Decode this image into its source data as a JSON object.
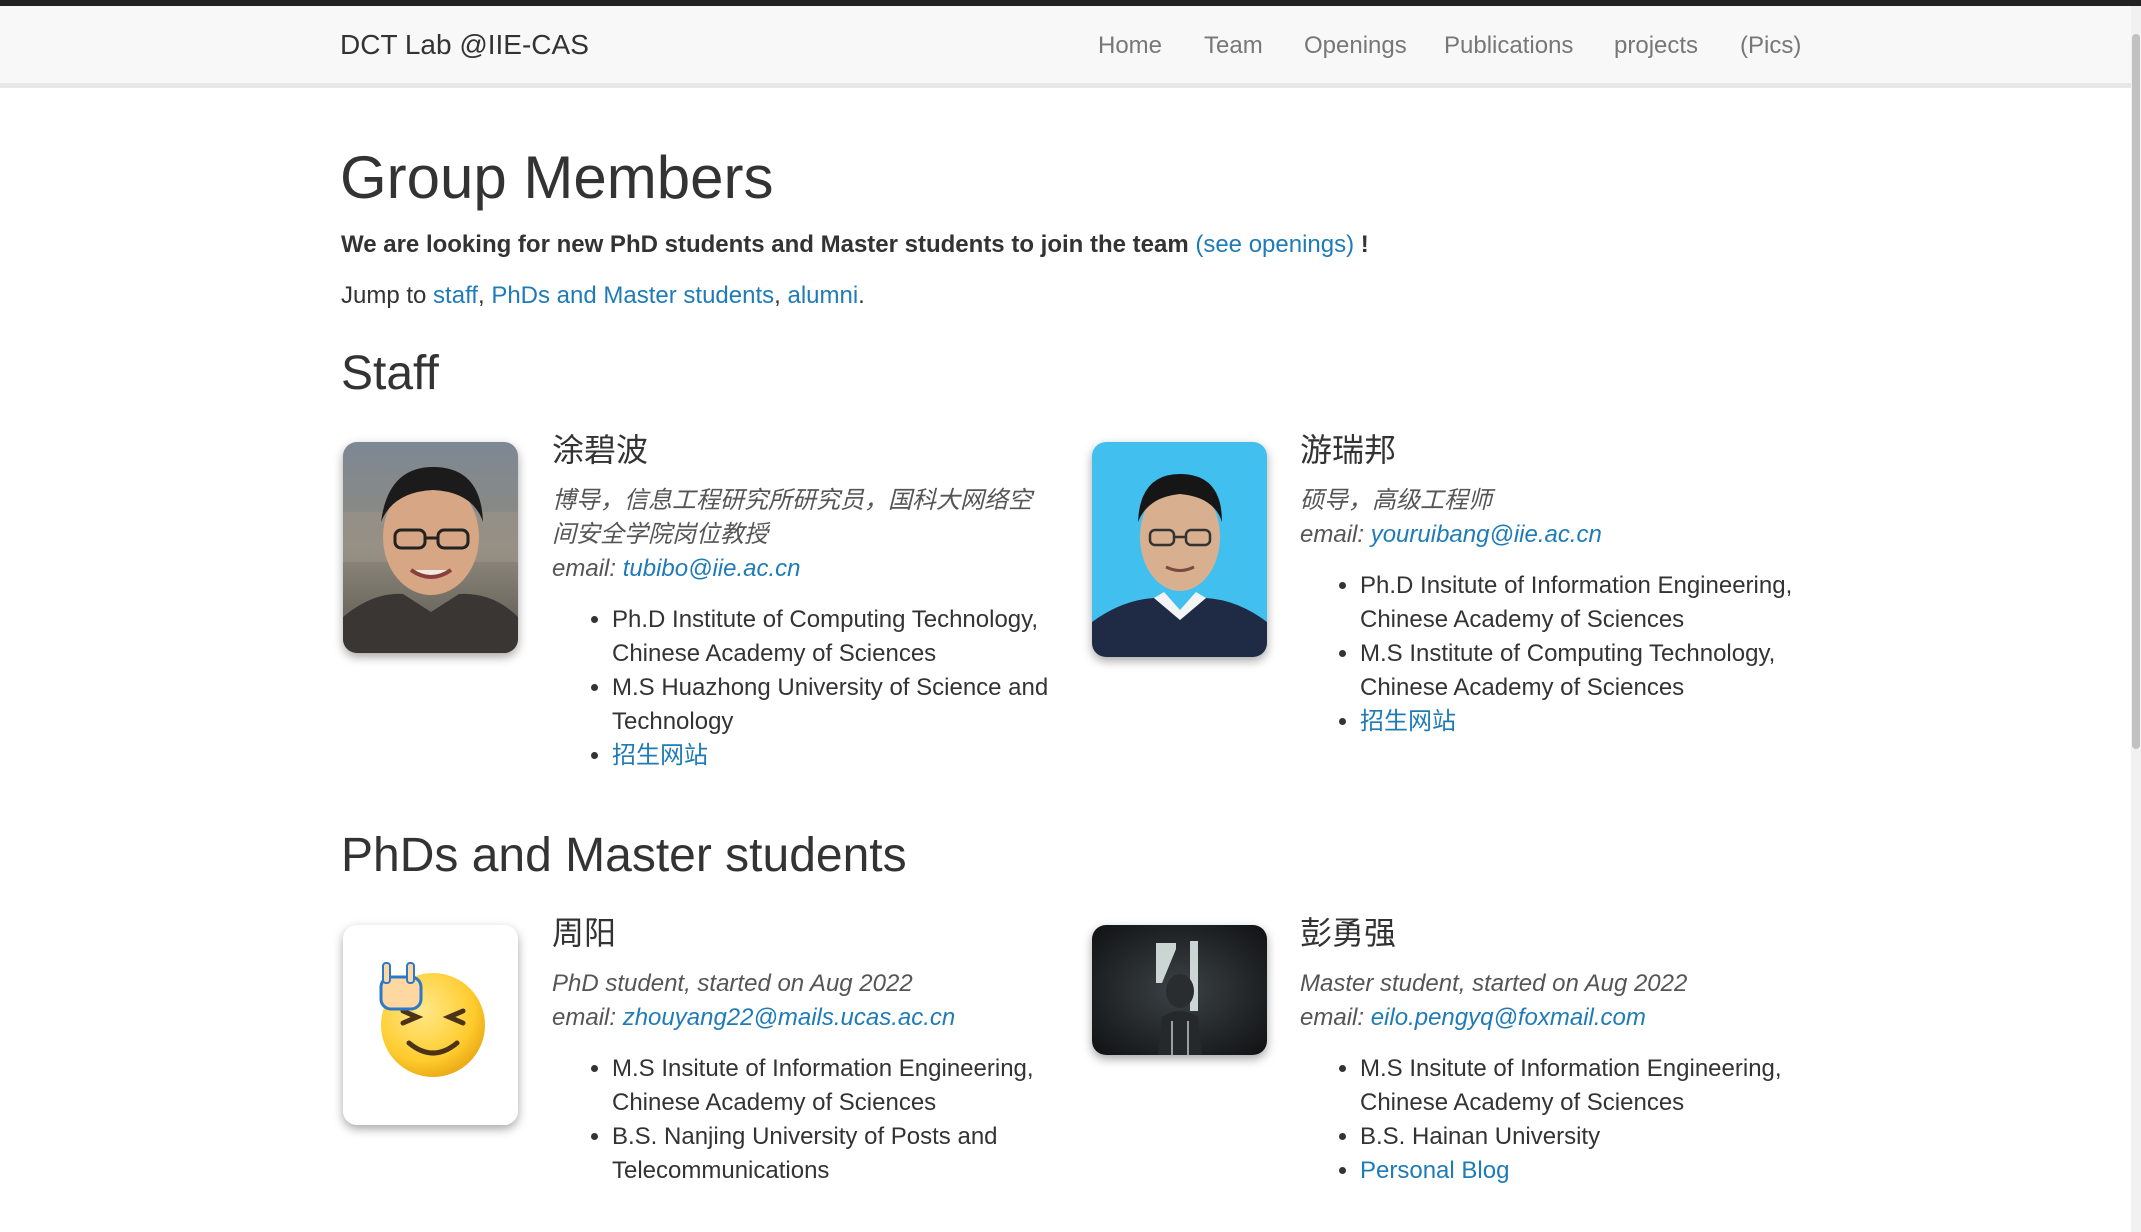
{
  "nav": {
    "brand": "DCT Lab @IIE-CAS",
    "items": [
      "Home",
      "Team",
      "Openings",
      "Publications",
      "projects",
      "(Pics)"
    ]
  },
  "page": {
    "title": "Group Members",
    "intro_bold": "We are looking for new PhD students and Master students to join the team",
    "intro_link": "(see openings)",
    "intro_end": "!",
    "jump_prefix": "Jump to",
    "jump_staff": "staff",
    "jump_sep1": ",",
    "jump_students": "PhDs and Master students",
    "jump_sep2": ",",
    "jump_alumni": "alumni",
    "jump_end": "."
  },
  "staff": {
    "heading": "Staff",
    "members": [
      {
        "name": "涂碧波",
        "role": "博导，信息工程研究所研究员，国科大网络空间安全学院岗位教授",
        "email_label": "email:",
        "email": "tubibo@iie.ac.cn",
        "items": [
          "Ph.D Institute of Computing Technology, Chinese Academy of Sciences",
          "M.S Huazhong University of Science and Technology"
        ],
        "link": "招生网站"
      },
      {
        "name": "游瑞邦",
        "role": "硕导，高级工程师",
        "email_label": "email:",
        "email": "youruibang@iie.ac.cn",
        "items": [
          "Ph.D Insitute of Information Engineering, Chinese Academy of Sciences",
          "M.S Institute of Computing Technology, Chinese Academy of Sciences"
        ],
        "link": "招生网站"
      }
    ]
  },
  "students": {
    "heading": "PhDs and Master students",
    "members": [
      {
        "name": "周阳",
        "role": "PhD student, started on Aug 2022",
        "email_label": "email:",
        "email": "zhouyang22@mails.ucas.ac.cn",
        "items": [
          "M.S Insitute of Information Engineering, Chinese Academy of Sciences",
          "B.S. Nanjing University of Posts and Telecommunications"
        ]
      },
      {
        "name": "彭勇强",
        "role": "Master student, started on Aug 2022",
        "email_label": "email:",
        "email": "eilo.pengyq@foxmail.com",
        "items": [
          "M.S Insitute of Information Engineering, Chinese Academy of Sciences",
          "B.S. Hainan University"
        ],
        "link": "Personal Blog"
      }
    ]
  },
  "colors": {
    "link": "#1f7bb6",
    "nav_text": "#777777",
    "navbar_bg": "#f8f8f8",
    "text": "#333333"
  }
}
